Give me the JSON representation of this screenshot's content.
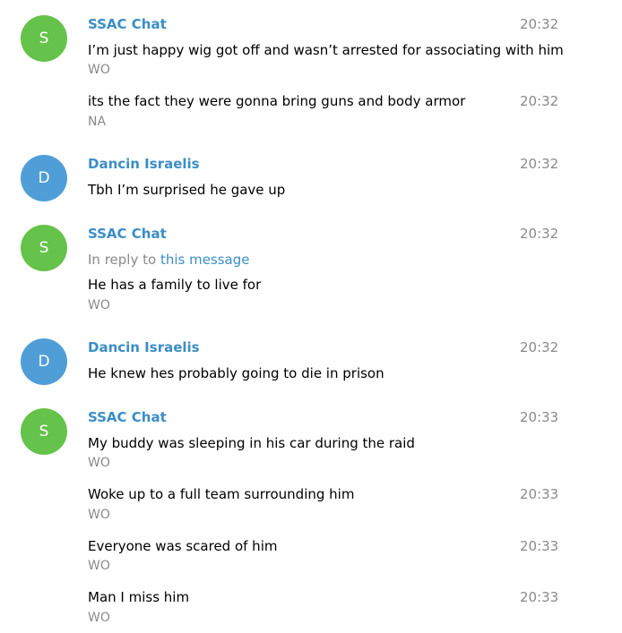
{
  "colors": {
    "green_avatar": "#65c24a",
    "blue_avatar": "#4f9ed8",
    "name": "#3b8ec6",
    "meta": "#8a8a8a"
  },
  "messages": [
    {
      "avatar_letter": "S",
      "sender": "SSAC Chat",
      "time": "20:32",
      "text": "I’m just happy wig got off and wasn’t arrested for associating with him",
      "signature": "WO"
    },
    {
      "time": "20:32",
      "text": "its the fact they were gonna bring guns and body armor",
      "signature": "NA"
    },
    {
      "avatar_letter": "D",
      "sender": "Dancin Israelis",
      "time": "20:32",
      "text": "Tbh I’m surprised he gave up"
    },
    {
      "avatar_letter": "S",
      "sender": "SSAC Chat",
      "time": "20:32",
      "reply_prefix": "In reply to",
      "reply_link": "this message",
      "text": "He has a family to live for",
      "signature": "WO"
    },
    {
      "avatar_letter": "D",
      "sender": "Dancin Israelis",
      "time": "20:32",
      "text": "He knew hes probably going to die in prison"
    },
    {
      "avatar_letter": "S",
      "sender": "SSAC Chat",
      "time": "20:33",
      "text": "My buddy was sleeping in his car during the raid",
      "signature": "WO"
    },
    {
      "time": "20:33",
      "text": "Woke up to a full team surrounding him",
      "signature": "WO"
    },
    {
      "time": "20:33",
      "text": "Everyone was scared of him",
      "signature": "WO"
    },
    {
      "time": "20:33",
      "text": "Man I miss him",
      "signature": "WO"
    }
  ]
}
